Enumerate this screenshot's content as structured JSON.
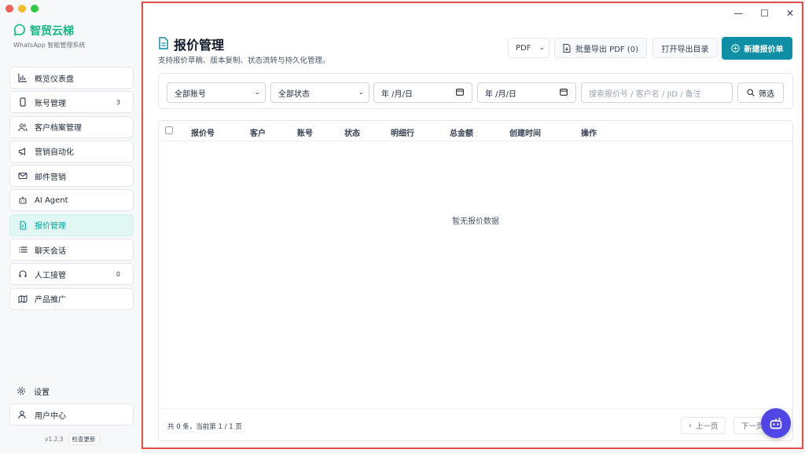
{
  "window": {
    "traffic_colors": [
      "#ee5f57",
      "#f5bd2e",
      "#2fc940"
    ],
    "controls": {
      "minimize": "—",
      "maximize": "☐",
      "close": "✕"
    }
  },
  "brand": {
    "name": "智贸云梯",
    "subtitle": "WhatsApp 智能管理系统",
    "color": "#10b981"
  },
  "sidebar": {
    "items": [
      {
        "label": "概览仪表盘",
        "icon": "bar-chart-icon",
        "count": ""
      },
      {
        "label": "账号管理",
        "icon": "phone-icon",
        "count": "3"
      },
      {
        "label": "客户档案管理",
        "icon": "users-icon",
        "count": ""
      },
      {
        "label": "营销自动化",
        "icon": "megaphone-icon",
        "count": ""
      },
      {
        "label": "邮件营销",
        "icon": "mail-icon",
        "count": ""
      },
      {
        "label": "AI Agent",
        "icon": "bot-icon",
        "count": ""
      },
      {
        "label": "报价管理",
        "icon": "document-icon",
        "count": "",
        "active": true
      },
      {
        "label": "聊天会话",
        "icon": "list-icon",
        "count": ""
      },
      {
        "label": "人工接管",
        "icon": "headset-icon",
        "count": "0"
      },
      {
        "label": "产品推广",
        "icon": "map-icon",
        "count": ""
      }
    ],
    "settings_label": "设置",
    "user_center_label": "用户中心",
    "version": "v1.2.3",
    "check_update_label": "检查更新"
  },
  "main": {
    "title": "报价管理",
    "subtitle": "支持报价草稿、版本复制、状态流转与持久化管理。",
    "format_select": "PDF",
    "batch_export_label": "批量导出 PDF (0)",
    "open_dir_label": "打开导出目录",
    "new_quote_label": "新建报价单",
    "accent_color": "#0e8fa6"
  },
  "filters": {
    "account_select": "全部账号",
    "status_select": "全部状态",
    "date_from": "年 /月/日",
    "date_to": "年 /月/日",
    "search_placeholder": "搜索报价号 / 客户名 / JID / 备注",
    "filter_button": "筛选"
  },
  "table": {
    "columns": [
      "报价号",
      "客户",
      "账号",
      "状态",
      "明细行",
      "总金额",
      "创建时间",
      "操作"
    ],
    "rows": [],
    "empty_text": "暂无报价数据",
    "total_text": "共 0 条，当前第 1 / 1 页",
    "prev_label": "上一页",
    "next_label": "下一页"
  }
}
